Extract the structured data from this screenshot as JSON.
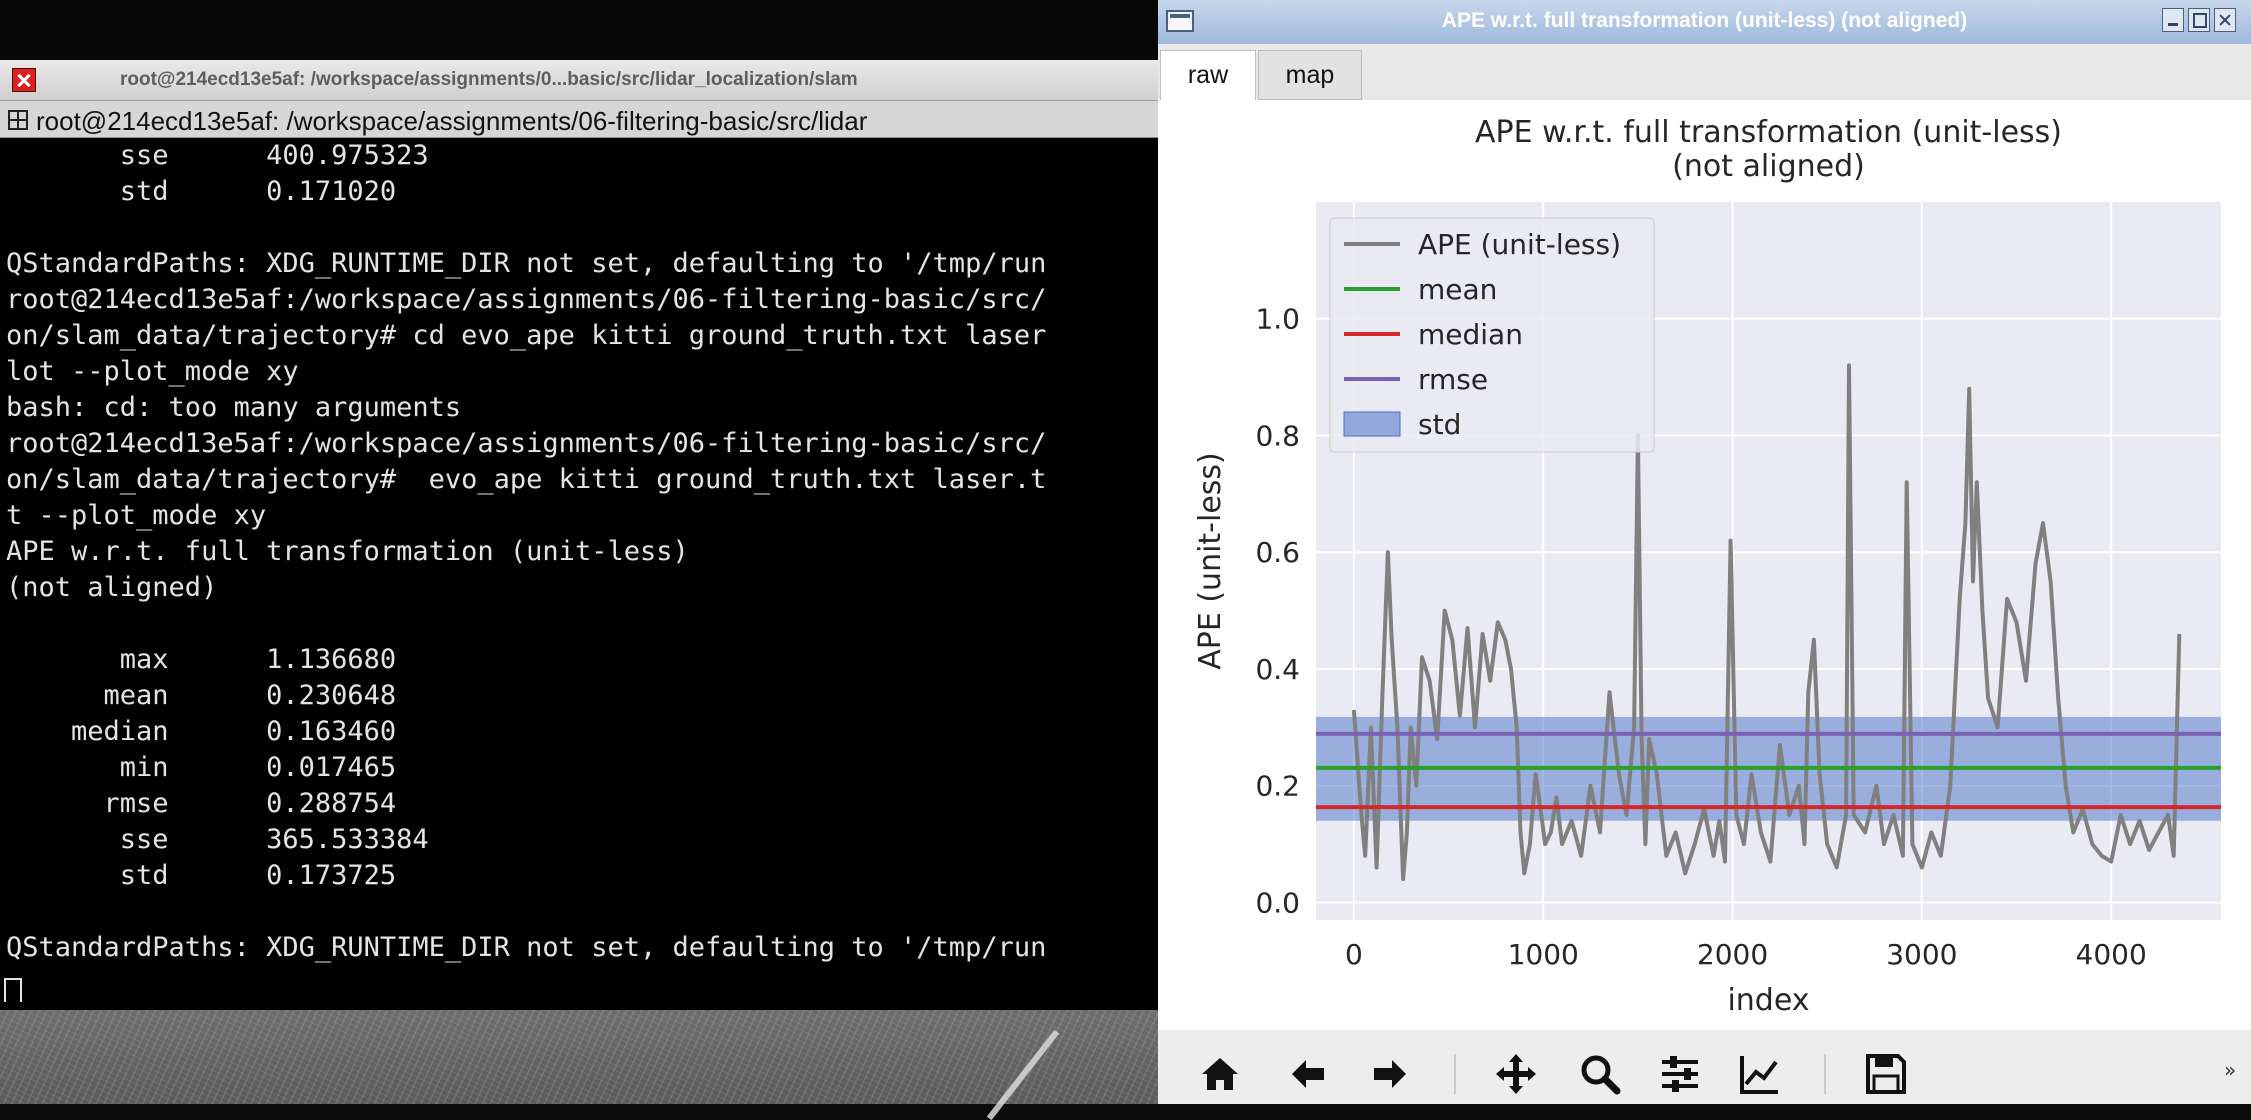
{
  "terminal": {
    "window_title": "root@214ecd13e5af: /workspace/assignments/0...basic/src/lidar_localization/slam",
    "tab_title": "root@214ecd13e5af: /workspace/assignments/06-filtering-basic/src/lidar",
    "lines": [
      "       sse      400.975323",
      "       std      0.171020",
      "",
      "QStandardPaths: XDG_RUNTIME_DIR not set, defaulting to '/tmp/run",
      "root@214ecd13e5af:/workspace/assignments/06-filtering-basic/src/",
      "on/slam_data/trajectory# cd evo_ape kitti ground_truth.txt laser",
      "lot --plot_mode xy",
      "bash: cd: too many arguments",
      "root@214ecd13e5af:/workspace/assignments/06-filtering-basic/src/",
      "on/slam_data/trajectory#  evo_ape kitti ground_truth.txt laser.t",
      "t --plot_mode xy",
      "APE w.r.t. full transformation (unit-less)",
      "(not aligned)",
      "",
      "       max      1.136680",
      "      mean      0.230648",
      "    median      0.163460",
      "       min      0.017465",
      "      rmse      0.288754",
      "       sse      365.533384",
      "       std      0.173725",
      "",
      "QStandardPaths: XDG_RUNTIME_DIR not set, defaulting to '/tmp/run"
    ]
  },
  "plot_window": {
    "title": "APE w.r.t. full transformation (unit-less) (not aligned)",
    "tabs": [
      "raw",
      "map"
    ],
    "active_tab": "raw",
    "toolbar": [
      "home-icon",
      "back-arrow-icon",
      "forward-arrow-icon",
      "pan-icon",
      "zoom-icon",
      "configure-subplots-icon",
      "edit-axis-icon",
      "save-icon"
    ],
    "more_label": "»"
  },
  "chart_data": {
    "type": "line",
    "title": "APE w.r.t. full transformation (unit-less)",
    "subtitle": "(not aligned)",
    "xlabel": "index",
    "ylabel": "APE (unit-less)",
    "xlim": [
      -200,
      4580
    ],
    "ylim": [
      -0.03,
      1.2
    ],
    "xticks": [
      0,
      1000,
      2000,
      3000,
      4000
    ],
    "yticks": [
      0.0,
      0.2,
      0.4,
      0.6,
      0.8,
      1.0
    ],
    "grid": true,
    "legend_position": "top-left",
    "legend": [
      "APE (unit-less)",
      "mean",
      "median",
      "rmse",
      "std"
    ],
    "colors": {
      "ape": "#808080",
      "mean": "#2ca02c",
      "median": "#d62728",
      "rmse": "#7b61b5",
      "std": "#4a72c8",
      "background": "#eaeaf2"
    },
    "statistics": {
      "max": 1.13668,
      "mean": 0.230648,
      "median": 0.16346,
      "min": 0.017465,
      "rmse": 0.288754,
      "std": 0.173725
    },
    "std_band": [
      0.14,
      0.318
    ],
    "series": [
      {
        "name": "APE (unit-less)",
        "x": [
          0,
          40,
          60,
          90,
          120,
          150,
          180,
          200,
          230,
          260,
          280,
          300,
          330,
          360,
          400,
          440,
          480,
          520,
          560,
          600,
          640,
          680,
          720,
          760,
          800,
          830,
          860,
          880,
          900,
          930,
          960,
          990,
          1010,
          1040,
          1070,
          1100,
          1150,
          1200,
          1250,
          1300,
          1350,
          1400,
          1440,
          1480,
          1500,
          1520,
          1540,
          1560,
          1600,
          1650,
          1700,
          1750,
          1800,
          1850,
          1900,
          1930,
          1960,
          1990,
          2020,
          2060,
          2100,
          2150,
          2200,
          2250,
          2300,
          2350,
          2380,
          2400,
          2430,
          2460,
          2500,
          2550,
          2600,
          2615,
          2640,
          2700,
          2760,
          2800,
          2850,
          2900,
          2920,
          2950,
          3000,
          3050,
          3100,
          3150,
          3200,
          3230,
          3250,
          3270,
          3290,
          3320,
          3350,
          3400,
          3450,
          3500,
          3550,
          3600,
          3640,
          3680,
          3720,
          3760,
          3800,
          3850,
          3900,
          3950,
          4000,
          4050,
          4100,
          4150,
          4200,
          4250,
          4300,
          4330,
          4360
        ],
        "y": [
          0.33,
          0.15,
          0.08,
          0.3,
          0.06,
          0.35,
          0.6,
          0.45,
          0.3,
          0.04,
          0.12,
          0.3,
          0.2,
          0.42,
          0.38,
          0.28,
          0.5,
          0.45,
          0.32,
          0.47,
          0.3,
          0.46,
          0.38,
          0.48,
          0.45,
          0.4,
          0.3,
          0.12,
          0.05,
          0.1,
          0.22,
          0.15,
          0.1,
          0.12,
          0.18,
          0.1,
          0.14,
          0.08,
          0.2,
          0.12,
          0.36,
          0.22,
          0.15,
          0.3,
          0.8,
          0.28,
          0.1,
          0.28,
          0.22,
          0.08,
          0.12,
          0.05,
          0.1,
          0.16,
          0.08,
          0.14,
          0.07,
          0.62,
          0.15,
          0.1,
          0.22,
          0.12,
          0.07,
          0.27,
          0.15,
          0.2,
          0.1,
          0.36,
          0.45,
          0.22,
          0.1,
          0.06,
          0.15,
          0.92,
          0.15,
          0.12,
          0.2,
          0.1,
          0.15,
          0.08,
          0.72,
          0.1,
          0.06,
          0.12,
          0.08,
          0.2,
          0.52,
          0.65,
          0.88,
          0.55,
          0.72,
          0.5,
          0.35,
          0.3,
          0.52,
          0.48,
          0.38,
          0.58,
          0.65,
          0.55,
          0.35,
          0.2,
          0.12,
          0.16,
          0.1,
          0.08,
          0.07,
          0.15,
          0.1,
          0.14,
          0.09,
          0.12,
          0.15,
          0.08,
          0.46
        ]
      },
      {
        "name": "mean",
        "value": 0.230648
      },
      {
        "name": "median",
        "value": 0.16346
      },
      {
        "name": "rmse",
        "value": 0.288754
      }
    ]
  }
}
